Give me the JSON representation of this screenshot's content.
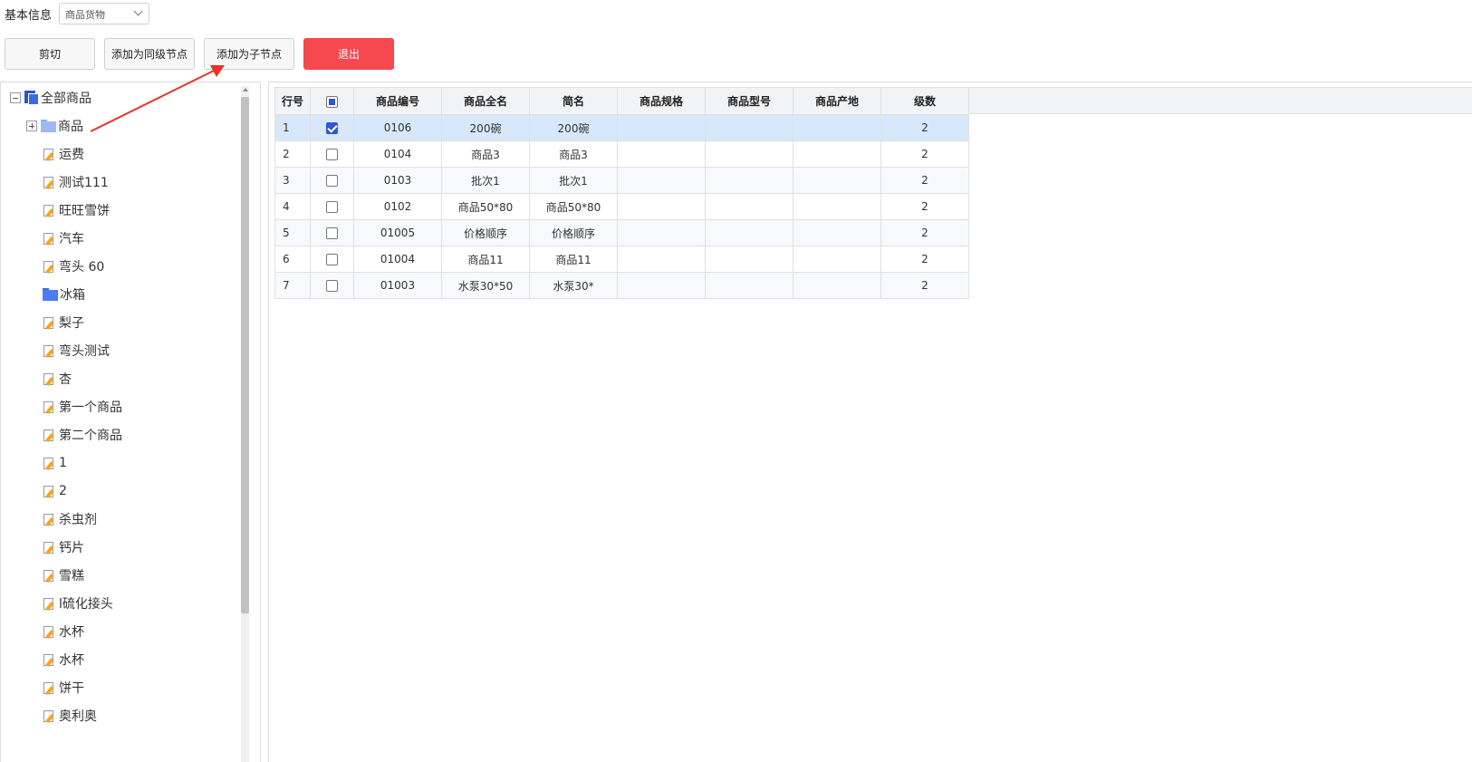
{
  "topbar": {
    "label": "基本信息",
    "select_value": "商品货物"
  },
  "toolbar": {
    "cut_label": "剪切",
    "add_sibling_label": "添加为同级节点",
    "add_child_label": "添加为子节点",
    "exit_label": "退出"
  },
  "tree": {
    "root": "全部商品",
    "items": [
      "商品",
      "运费",
      "测试111",
      "旺旺雪饼",
      "汽车",
      "弯头 60",
      "冰箱",
      "梨子",
      "弯头测试",
      "杏",
      "第一个商品",
      "第二个商品",
      "1",
      "2",
      "杀虫剂",
      "钙片",
      "雪糕",
      "l硫化接头",
      "水杯",
      "水杯",
      "饼干",
      "奥利奥"
    ]
  },
  "grid": {
    "columns": [
      "行号",
      "",
      "商品编号",
      "商品全名",
      "简名",
      "商品规格",
      "商品型号",
      "商品产地",
      "级数"
    ],
    "rows": [
      {
        "no": "1",
        "checked": true,
        "code": "0106",
        "name": "200碗",
        "short": "200碗",
        "spec": "",
        "model": "",
        "origin": "",
        "level": "2"
      },
      {
        "no": "2",
        "checked": false,
        "code": "0104",
        "name": "商品3",
        "short": "商品3",
        "spec": "",
        "model": "",
        "origin": "",
        "level": "2"
      },
      {
        "no": "3",
        "checked": false,
        "code": "0103",
        "name": "批次1",
        "short": "批次1",
        "spec": "",
        "model": "",
        "origin": "",
        "level": "2"
      },
      {
        "no": "4",
        "checked": false,
        "code": "0102",
        "name": "商品50*80",
        "short": "商品50*80",
        "spec": "",
        "model": "",
        "origin": "",
        "level": "2"
      },
      {
        "no": "5",
        "checked": false,
        "code": "01005",
        "name": "价格顺序",
        "short": "价格顺序",
        "spec": "",
        "model": "",
        "origin": "",
        "level": "2"
      },
      {
        "no": "6",
        "checked": false,
        "code": "01004",
        "name": "商品11",
        "short": "商品11",
        "spec": "",
        "model": "",
        "origin": "",
        "level": "2"
      },
      {
        "no": "7",
        "checked": false,
        "code": "01003",
        "name": "水泵30*50",
        "short": "水泵30*",
        "spec": "",
        "model": "",
        "origin": "",
        "level": "2"
      }
    ]
  },
  "colors": {
    "exit_button": "#f5484f",
    "annotation_arrow": "#e8322b",
    "selected_row": "#d7e8fb",
    "checkbox_checked": "#2f57d0"
  }
}
